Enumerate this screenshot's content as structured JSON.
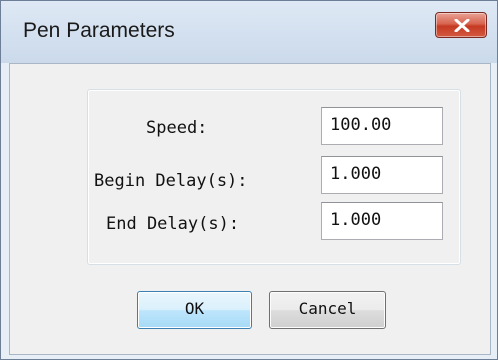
{
  "window": {
    "title": "Pen Parameters"
  },
  "fields": [
    {
      "label": "Speed:",
      "value": "100.00"
    },
    {
      "label": "Begin Delay(s):",
      "value": "1.000"
    },
    {
      "label": "End Delay(s):",
      "value": "1.000"
    }
  ],
  "buttons": {
    "ok": "OK",
    "cancel": "Cancel"
  },
  "icons": {
    "close": "close-icon"
  },
  "colors": {
    "close_button": "#c43a22",
    "default_button_border": "#3c7fb1",
    "titlebar": "#d3e0ef"
  }
}
